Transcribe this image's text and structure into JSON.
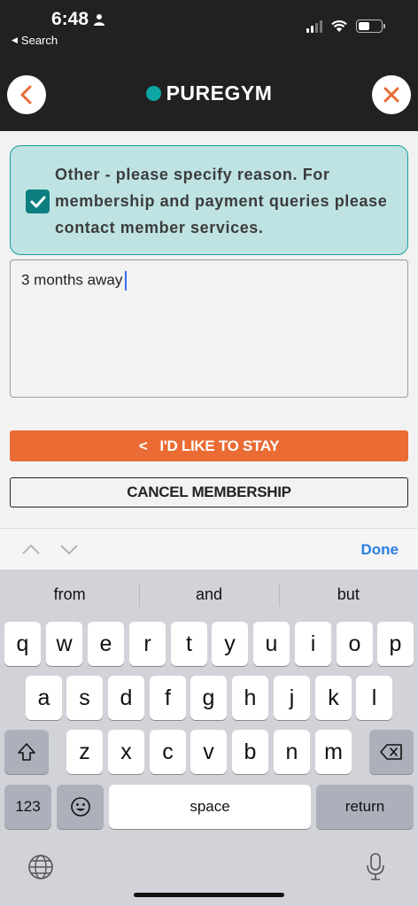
{
  "status_bar": {
    "time": "6:48",
    "back_app": "Search"
  },
  "header": {
    "brand": "PUREGYM"
  },
  "form": {
    "option_text": "Other - please specify reason. For membership and payment queries please contact member services.",
    "reason_value": "3 months away",
    "stay_icon": "<",
    "stay_label": "I'D LIKE TO STAY",
    "cancel_label": "CANCEL MEMBERSHIP"
  },
  "accessory": {
    "done_label": "Done"
  },
  "keyboard": {
    "suggestions": [
      "from",
      "and",
      "but"
    ],
    "row1": [
      "q",
      "w",
      "e",
      "r",
      "t",
      "y",
      "u",
      "i",
      "o",
      "p"
    ],
    "row2": [
      "a",
      "s",
      "d",
      "f",
      "g",
      "h",
      "j",
      "k",
      "l"
    ],
    "row3": [
      "z",
      "x",
      "c",
      "v",
      "b",
      "n",
      "m"
    ],
    "numbers_label": "123",
    "space_label": "space",
    "return_label": "return"
  },
  "colors": {
    "brand_teal": "#0ea5a5",
    "accent_orange": "#ea6b33",
    "header_bg": "#212121",
    "done_blue": "#2a7ee0"
  }
}
